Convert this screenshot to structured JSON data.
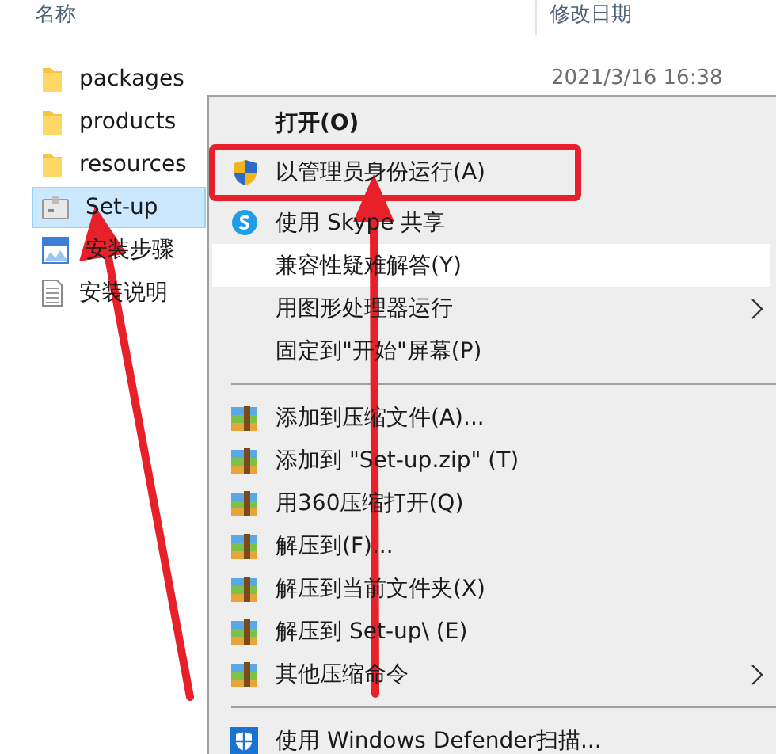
{
  "columns": [
    {
      "label": "名称"
    },
    {
      "label": "修改日期"
    }
  ],
  "files": [
    {
      "name": "packages",
      "kind": "folder",
      "date": "2021/3/16 16:38",
      "selected": false
    },
    {
      "name": "products",
      "kind": "folder",
      "selected": false
    },
    {
      "name": "resources",
      "kind": "folder",
      "selected": false
    },
    {
      "name": "Set-up",
      "kind": "installer",
      "selected": true
    },
    {
      "name": "安装步骤",
      "kind": "image",
      "selected": false
    },
    {
      "name": "安装说明",
      "kind": "text",
      "selected": false
    }
  ],
  "context_menu": {
    "items": [
      {
        "kind": "plain",
        "label": "打开(O)",
        "bold": true,
        "hovered": false,
        "highlighted": false,
        "submenu": false
      },
      {
        "kind": "admin",
        "label": "以管理员身份运行(A)",
        "bold": false,
        "hovered": false,
        "highlighted": true,
        "submenu": false
      },
      {
        "kind": "share",
        "label": "使用 Skype 共享",
        "bold": false,
        "hovered": false,
        "highlighted": false,
        "submenu": false
      },
      {
        "kind": "plain",
        "label": "兼容性疑难解答(Y)",
        "bold": false,
        "hovered": true,
        "highlighted": false,
        "submenu": false
      },
      {
        "kind": "plain",
        "label": "用图形处理器运行",
        "bold": false,
        "hovered": false,
        "highlighted": false,
        "submenu": true
      },
      {
        "kind": "plain",
        "label": "固定到\"开始\"屏幕(P)",
        "bold": false,
        "hovered": false,
        "highlighted": false,
        "submenu": false
      },
      {
        "kind": "separator"
      },
      {
        "kind": "archive",
        "label": "添加到压缩文件(A)...",
        "bold": false,
        "hovered": false,
        "highlighted": false,
        "submenu": false
      },
      {
        "kind": "archive",
        "label": "添加到 \"Set-up.zip\" (T)",
        "bold": false,
        "hovered": false,
        "highlighted": false,
        "submenu": false
      },
      {
        "kind": "archive",
        "label": "用360压缩打开(Q)",
        "bold": false,
        "hovered": false,
        "highlighted": false,
        "submenu": false
      },
      {
        "kind": "archive",
        "label": "解压到(F)...",
        "bold": false,
        "hovered": false,
        "highlighted": false,
        "submenu": false
      },
      {
        "kind": "archive",
        "label": "解压到当前文件夹(X)",
        "bold": false,
        "hovered": false,
        "highlighted": false,
        "submenu": false
      },
      {
        "kind": "archive",
        "label": "解压到 Set-up\\ (E)",
        "bold": false,
        "hovered": false,
        "highlighted": false,
        "submenu": false
      },
      {
        "kind": "archive",
        "label": "其他压缩命令",
        "bold": false,
        "hovered": false,
        "highlighted": false,
        "submenu": true
      },
      {
        "kind": "separator"
      },
      {
        "kind": "defender",
        "label": "使用 Windows Defender扫描...",
        "bold": false,
        "hovered": false,
        "highlighted": false,
        "submenu": false
      }
    ]
  }
}
